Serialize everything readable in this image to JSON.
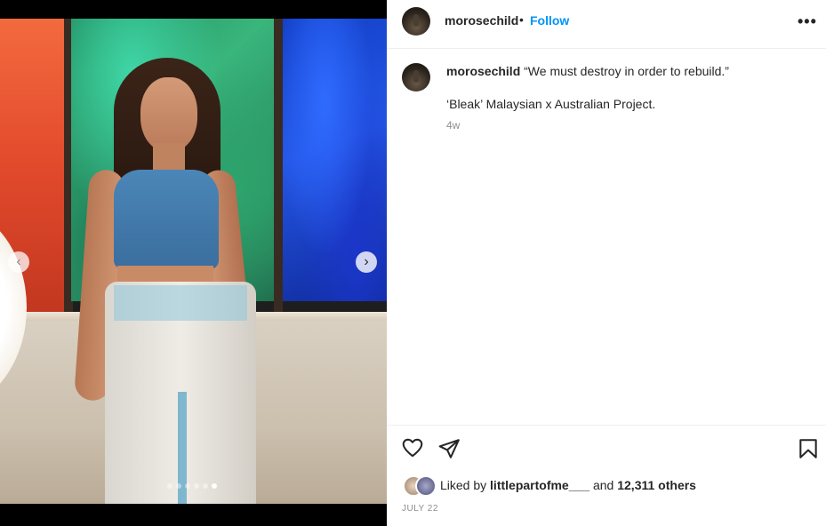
{
  "post": {
    "username": "morosechild",
    "follow_label": "Follow",
    "separator": "•",
    "more_label": "•••"
  },
  "caption": {
    "username": "morosechild",
    "text": "“We must destroy in order to rebuild.”",
    "line2": "‘Bleak’ Malaysian x Australian Project.",
    "time_ago": "4w"
  },
  "carousel": {
    "prev_label": "‹",
    "next_label": "›",
    "slide_count": 6,
    "active_index": 5
  },
  "actions": {
    "like_icon": "heart-icon",
    "share_icon": "send-icon",
    "save_icon": "bookmark-icon"
  },
  "likes": {
    "prefix": "Liked by",
    "liker": "littlepartofme___",
    "middle": "and",
    "others": "12,311 others"
  },
  "date": "JULY 22",
  "colors": {
    "accent": "#0095f6",
    "text": "#262626",
    "muted": "#8e8e8e"
  }
}
